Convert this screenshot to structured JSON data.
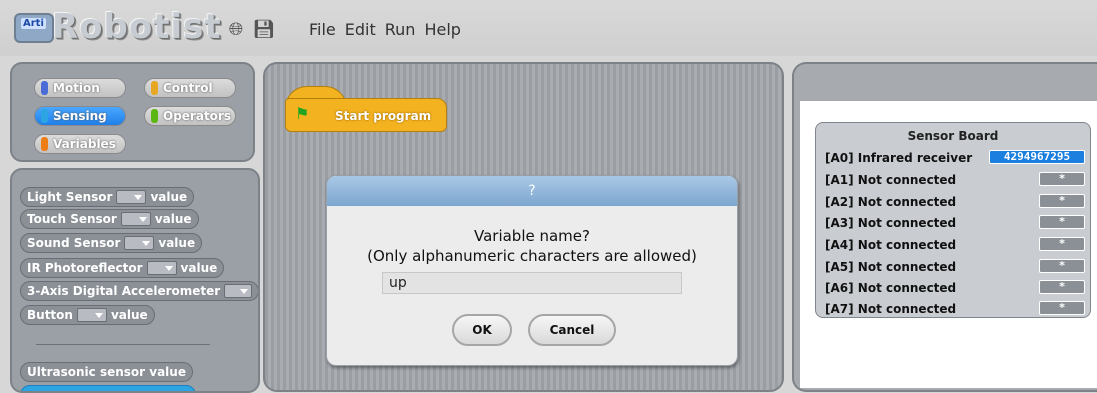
{
  "app": {
    "logo_text": "Robotist",
    "logo_badge": "Arti"
  },
  "toolbar": {
    "globe_icon": "globe-icon",
    "save_icon": "floppy-disk-icon"
  },
  "menu": [
    "File",
    "Edit",
    "Run",
    "Help"
  ],
  "categories": [
    {
      "label": "Motion",
      "color": "#4a6cd4"
    },
    {
      "label": "Control",
      "color": "#e6a822"
    },
    {
      "label": "Sensing",
      "color": "#2ca5e2",
      "selected": true
    },
    {
      "label": "Operators",
      "color": "#5cb712"
    },
    {
      "label": "Variables",
      "color": "#ee7d16"
    }
  ],
  "blocks": [
    {
      "name": "Light Sensor",
      "suffix": "value"
    },
    {
      "name": "Touch Sensor",
      "suffix": "value"
    },
    {
      "name": "Sound Sensor",
      "suffix": "value"
    },
    {
      "name": "IR Photoreflector",
      "suffix": "value"
    },
    {
      "name": "3-Axis Digital Accelerometer",
      "suffix": ""
    },
    {
      "name": "Button",
      "suffix": "value"
    },
    {
      "name": "Ultrasonic sensor value",
      "suffix": ""
    }
  ],
  "script": {
    "hat_label": "Start program"
  },
  "sensor_board": {
    "title": "Sensor Board",
    "rows": [
      {
        "label": "[A0] Infrared receiver",
        "value": "4294967295"
      },
      {
        "label": "[A1] Not connected",
        "value": "*"
      },
      {
        "label": "[A2] Not connected",
        "value": "*"
      },
      {
        "label": "[A3] Not connected",
        "value": "*"
      },
      {
        "label": "[A4] Not connected",
        "value": "*"
      },
      {
        "label": "[A5] Not connected",
        "value": "*"
      },
      {
        "label": "[A6] Not connected",
        "value": "*"
      },
      {
        "label": "[A7] Not connected",
        "value": "*"
      }
    ]
  },
  "dialog": {
    "title": "?",
    "line1": "Variable name?",
    "line2": "(Only alphanumeric characters are allowed)",
    "input_value": "up",
    "ok_label": "OK",
    "cancel_label": "Cancel"
  }
}
